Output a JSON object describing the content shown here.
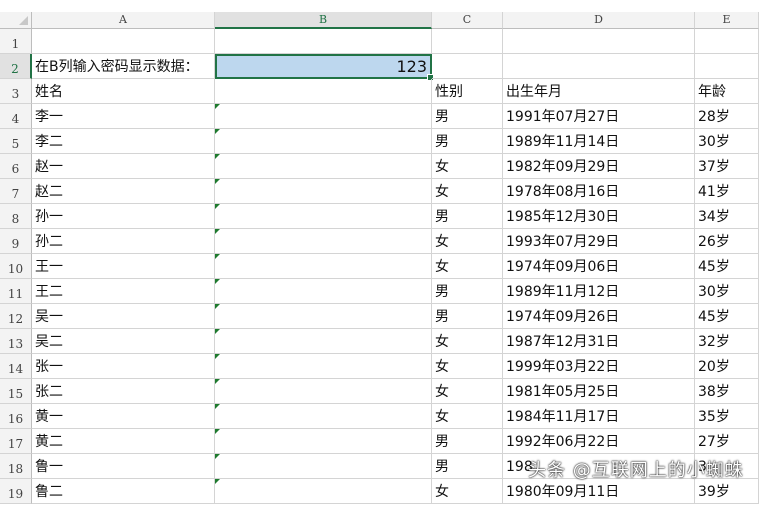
{
  "columns": [
    "A",
    "B",
    "C",
    "D",
    "E"
  ],
  "prompt_label": "在B列输入密码显示数据：",
  "password_value": "123",
  "headers": {
    "name": "姓名",
    "gender": "性别",
    "birth": "出生年月",
    "age": "年龄"
  },
  "rows": [
    {
      "n": "4",
      "name": "李一",
      "gender": "男",
      "birth": "1991年07月27日",
      "age": "28岁"
    },
    {
      "n": "5",
      "name": "李二",
      "gender": "男",
      "birth": "1989年11月14日",
      "age": "30岁"
    },
    {
      "n": "6",
      "name": "赵一",
      "gender": "女",
      "birth": "1982年09月29日",
      "age": "37岁"
    },
    {
      "n": "7",
      "name": "赵二",
      "gender": "女",
      "birth": "1978年08月16日",
      "age": "41岁"
    },
    {
      "n": "8",
      "name": "孙一",
      "gender": "男",
      "birth": "1985年12月30日",
      "age": "34岁"
    },
    {
      "n": "9",
      "name": "孙二",
      "gender": "女",
      "birth": "1993年07月29日",
      "age": "26岁"
    },
    {
      "n": "10",
      "name": "王一",
      "gender": "女",
      "birth": "1974年09月06日",
      "age": "45岁"
    },
    {
      "n": "11",
      "name": "王二",
      "gender": "男",
      "birth": "1989年11月12日",
      "age": "30岁"
    },
    {
      "n": "12",
      "name": "吴一",
      "gender": "男",
      "birth": "1974年09月26日",
      "age": "45岁"
    },
    {
      "n": "13",
      "name": "吴二",
      "gender": "女",
      "birth": "1987年12月31日",
      "age": "32岁"
    },
    {
      "n": "14",
      "name": "张一",
      "gender": "女",
      "birth": "1999年03月22日",
      "age": "20岁"
    },
    {
      "n": "15",
      "name": "张二",
      "gender": "女",
      "birth": "1981年05月25日",
      "age": "38岁"
    },
    {
      "n": "16",
      "name": "黄一",
      "gender": "女",
      "birth": "1984年11月17日",
      "age": "35岁"
    },
    {
      "n": "17",
      "name": "黄二",
      "gender": "男",
      "birth": "1992年06月22日",
      "age": "27岁"
    },
    {
      "n": "18",
      "name": "鲁一",
      "gender": "男",
      "birth": "198",
      "age": "3"
    },
    {
      "n": "19",
      "name": "鲁二",
      "gender": "女",
      "birth": "1980年09月11日",
      "age": "39岁"
    }
  ],
  "watermark": "头条 @互联网上的小蜘蛛"
}
